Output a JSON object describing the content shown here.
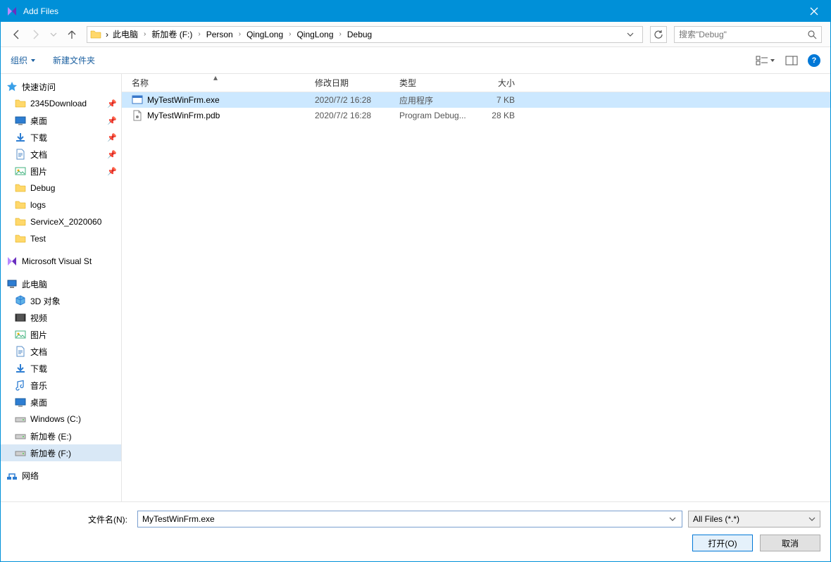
{
  "titlebar": {
    "title": "Add Files"
  },
  "breadcrumb": {
    "segments": [
      "此电脑",
      "新加卷 (F:)",
      "Person",
      "QingLong",
      "QingLong",
      "Debug"
    ]
  },
  "search": {
    "placeholder": "搜索\"Debug\""
  },
  "toolbar": {
    "organize": "组织",
    "new_folder": "新建文件夹"
  },
  "columns": {
    "name": "名称",
    "date": "修改日期",
    "type": "类型",
    "size": "大小"
  },
  "files": [
    {
      "name": "MyTestWinFrm.exe",
      "date": "2020/7/2 16:28",
      "type": "应用程序",
      "size": "7 KB",
      "selected": true,
      "fileicon": "exe"
    },
    {
      "name": "MyTestWinFrm.pdb",
      "date": "2020/7/2 16:28",
      "type": "Program Debug...",
      "size": "28 KB",
      "selected": false,
      "fileicon": "pdb"
    }
  ],
  "sidebar": {
    "quick_access": {
      "label": "快速访问",
      "items": [
        {
          "label": "2345Download",
          "icon": "folder",
          "pin": true
        },
        {
          "label": "桌面",
          "icon": "desktop",
          "pin": true
        },
        {
          "label": "下载",
          "icon": "download",
          "pin": true
        },
        {
          "label": "文档",
          "icon": "doc",
          "pin": true
        },
        {
          "label": "图片",
          "icon": "pic",
          "pin": true
        },
        {
          "label": "Debug",
          "icon": "folder",
          "pin": false
        },
        {
          "label": "logs",
          "icon": "folder",
          "pin": false
        },
        {
          "label": "ServiceX_2020060",
          "icon": "folder",
          "pin": false
        },
        {
          "label": "Test",
          "icon": "folder",
          "pin": false
        }
      ]
    },
    "vs": {
      "label": "Microsoft Visual St"
    },
    "this_pc": {
      "label": "此电脑",
      "items": [
        {
          "label": "3D 对象",
          "icon": "3d"
        },
        {
          "label": "视频",
          "icon": "video"
        },
        {
          "label": "图片",
          "icon": "pic"
        },
        {
          "label": "文档",
          "icon": "doc"
        },
        {
          "label": "下载",
          "icon": "download"
        },
        {
          "label": "音乐",
          "icon": "music"
        },
        {
          "label": "桌面",
          "icon": "desktop"
        },
        {
          "label": "Windows (C:)",
          "icon": "drive"
        },
        {
          "label": "新加卷 (E:)",
          "icon": "drive"
        },
        {
          "label": "新加卷 (F:)",
          "icon": "drive",
          "selected": true
        }
      ]
    },
    "network": {
      "label": "网络"
    }
  },
  "footer": {
    "filename_label": "文件名(N):",
    "filename_value": "MyTestWinFrm.exe",
    "filter": "All Files (*.*)",
    "open": "打开(O)",
    "cancel": "取消"
  }
}
